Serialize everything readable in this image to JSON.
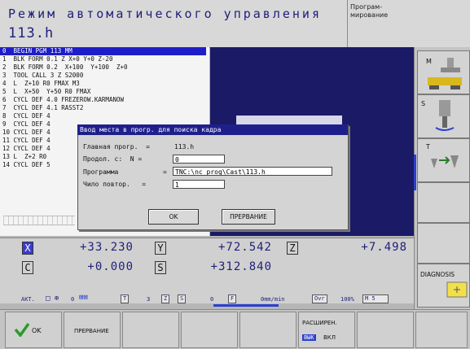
{
  "header": {
    "mode_title": "Режим автоматического управления",
    "file_name": "113.h",
    "right_mode": "Програм-\nмирование"
  },
  "program": {
    "lines": [
      "0  BEGIN PGM 113 MM",
      "1  BLK FORM 0.1 Z X+0 Y+0 Z-20",
      "2  BLK FORM 0.2  X+100  Y+100  Z+0",
      "3  TOOL CALL 3 Z S2000",
      "4  L  Z+10 R0 FMAX M3",
      "5  L  X+50  Y+50 R0 FMAX",
      "6  CYCL DEF 4.0 FREZEROW.KARMANOW",
      "7  CYCL DEF 4.1 RASST2",
      "8  CYCL DEF 4",
      "9  CYCL DEF 4",
      "10 CYCL DEF 4",
      "11 CYCL DEF 4",
      "12 CYCL DEF 4",
      "13 L  Z+2 R0",
      "14 CYCL DEF 5"
    ]
  },
  "dialog": {
    "title": "Ввод места в прогр. для поиска кадра",
    "main_prog_label": "Главная прогр.  =",
    "main_prog_value": "113.h",
    "continue_label": "Продол. с:  N =",
    "continue_value": "0",
    "program_label": "Программа",
    "program_value": "TNC:\\nc_prog\\Cast\\113.h",
    "repeat_label": "Чило повтор.   =",
    "repeat_value": "1",
    "ok_label": "OK",
    "cancel_label": "ПРЕРВАНИЕ"
  },
  "positions": {
    "rows": [
      {
        "axis": "X",
        "value": "+33.230",
        "active": true
      },
      {
        "axis": "Y",
        "value": "+72.542",
        "active": false
      },
      {
        "axis": "Z",
        "value": "+7.498",
        "active": false
      },
      {
        "axis": "C",
        "value": "+0.000",
        "active": false
      },
      {
        "axis": "S",
        "value": "+312.840",
        "active": false
      }
    ]
  },
  "status": {
    "akt": "АКТ.",
    "t_label": "T",
    "t_value": "3",
    "z_label": "Z",
    "s_label": "S",
    "s_value": "0",
    "f_label": "F",
    "f_value": "0mm/min",
    "ovr_label": "Ovr",
    "ovr_value": "100%",
    "m_value": "M 5",
    "zero": "0"
  },
  "right_softkeys": {
    "m": "M",
    "s": "S",
    "t": "T",
    "diagnosis": "DIAGNOSIS"
  },
  "bottom_softkeys": {
    "ok": "OK",
    "cancel": "ПРЕРВАНИЕ",
    "expand": "РАСШИРЕН.",
    "off": "ВЫК",
    "on": "ВКЛ"
  },
  "colors": {
    "accent": "#1f1f8c",
    "graphic_bg": "#1a1a66",
    "text_blue": "#1f1f7a"
  }
}
